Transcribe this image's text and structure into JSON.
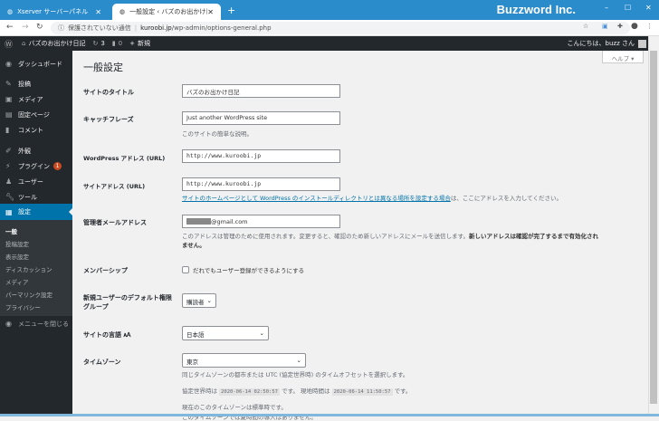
{
  "browser": {
    "tabs": [
      {
        "label": "Xserver サーバーパネル"
      },
      {
        "label": "一般設定 ‹ バズのお出かけ日記 — "
      }
    ],
    "brand": "Buzzword Inc.",
    "security": "保護されていない通信",
    "url_host": "kuroobi.jp",
    "url_path": "/wp-admin/options-general.php"
  },
  "adminbar": {
    "site": "バズのお出かけ日記",
    "updates": "3",
    "comments": "0",
    "new": "新規",
    "greeting": "こんにちは、buzz さん"
  },
  "sidebar": {
    "items": [
      {
        "label": "ダッシュボード"
      },
      {
        "label": "投稿"
      },
      {
        "label": "メディア"
      },
      {
        "label": "固定ページ"
      },
      {
        "label": "コメント"
      },
      {
        "label": "外観"
      },
      {
        "label": "プラグイン",
        "badge": "1"
      },
      {
        "label": "ユーザー"
      },
      {
        "label": "ツール"
      },
      {
        "label": "設定"
      }
    ],
    "submenu": [
      "一般",
      "投稿設定",
      "表示設定",
      "ディスカッション",
      "メディア",
      "パーマリンク設定",
      "プライバシー"
    ],
    "collapse": "メニューを閉じる"
  },
  "page": {
    "title": "一般設定",
    "help": "ヘルプ ▾",
    "fields": {
      "site_title": {
        "label": "サイトのタイトル",
        "value": "バズのお出かけ日記"
      },
      "tagline": {
        "label": "キャッチフレーズ",
        "value": "Just another WordPress site",
        "desc": "このサイトの簡単な説明。"
      },
      "wp_url": {
        "label": "WordPress アドレス (URL)",
        "value": "http://www.kuroobi.jp"
      },
      "site_url": {
        "label": "サイトアドレス (URL)",
        "value": "http://www.kuroobi.jp",
        "link": "サイトのホームページとして WordPress のインストールディレクトリとは異なる場所を設定する場合",
        "desc_tail": "は、ここにアドレスを入力してください。"
      },
      "email": {
        "label": "管理者メールアドレス",
        "value": "@gmail.com",
        "desc1": "このアドレスは管理のために使用されます。変更すると、確認のため新しいアドレスにメールを送信します。",
        "desc_bold": "新しいアドレスは確認が完了するまで有効化されません。"
      },
      "membership": {
        "label": "メンバーシップ",
        "checkbox": "だれでもユーザー登録ができるようにする",
        "checked": false
      },
      "role": {
        "label": "新規ユーザーのデフォルト権限グループ",
        "value": "購読者"
      },
      "language": {
        "label": "サイトの言語",
        "value": "日本語"
      },
      "timezone": {
        "label": "タイムゾーン",
        "value": "東京",
        "desc": "同じタイムゾーンの都市または UTC (協定世界時) のタイムオフセットを選択します。",
        "utc_prefix": "協定世界時は",
        "utc": "2020-06-14 02:50:57",
        "mid": "です。 現地時間は",
        "local": "2020-06-14 11:50:57",
        "suffix": "です。",
        "dst1": "現在のこのタイムゾーンは標準時です。",
        "dst2": "このタイムゾーンでは夏時間の導入はありません。"
      }
    }
  }
}
